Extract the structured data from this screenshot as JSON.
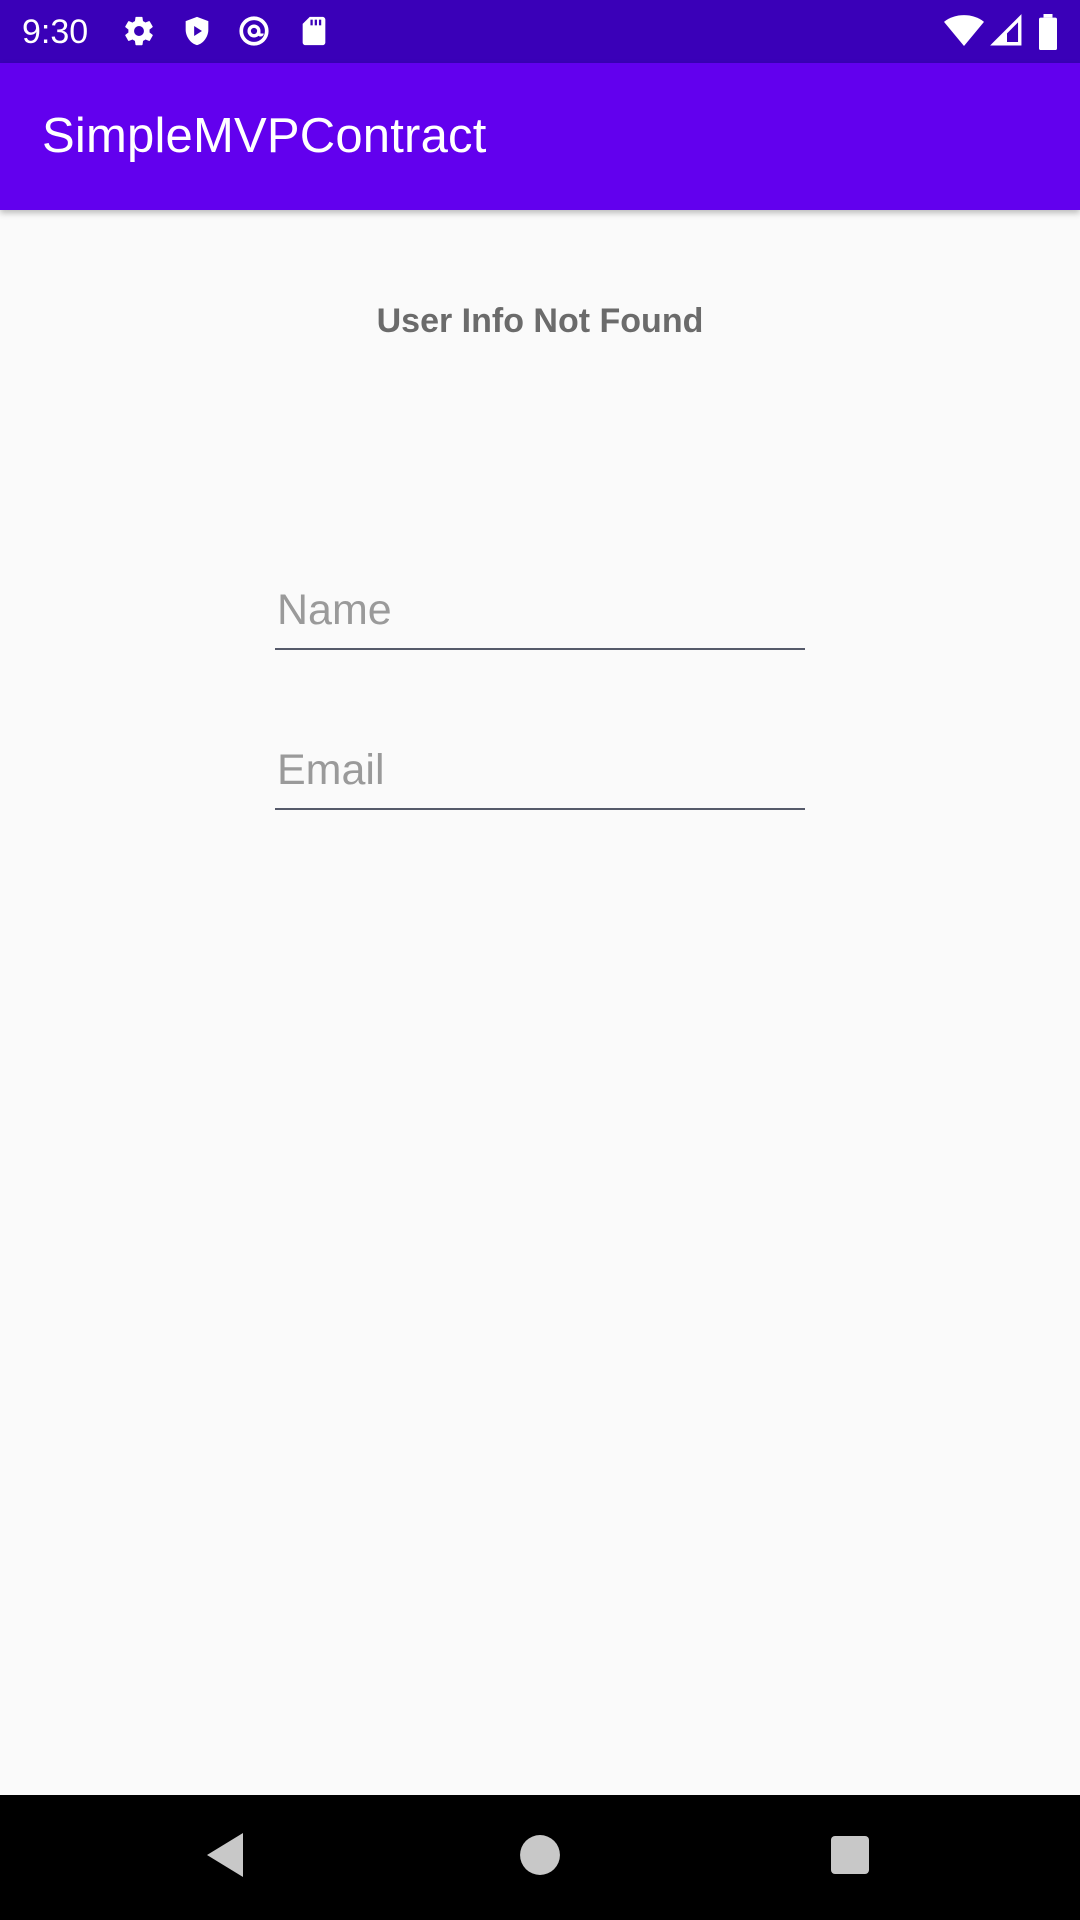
{
  "status_bar": {
    "time": "9:30",
    "icons": [
      "settings-icon",
      "play-protect-icon",
      "at-sign-icon",
      "sd-card-icon",
      "wifi-icon",
      "signal-icon",
      "battery-icon"
    ],
    "bg_color": "#3a00b8"
  },
  "app_bar": {
    "title": "SimpleMVPContract",
    "bg_color": "#6200ee"
  },
  "main": {
    "status_text": "User Info Not Found",
    "name_field": {
      "placeholder": "Name",
      "value": ""
    },
    "email_field": {
      "placeholder": "Email",
      "value": ""
    }
  },
  "nav_bar": {
    "buttons": [
      "back-icon",
      "home-icon",
      "recents-icon"
    ]
  }
}
